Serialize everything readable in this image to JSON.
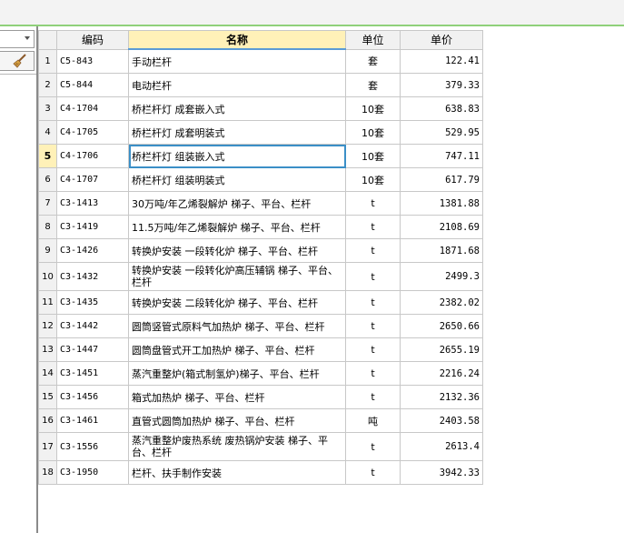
{
  "columns": {
    "code": "编码",
    "name": "名称",
    "unit": "单位",
    "price": "单价"
  },
  "rows": [
    {
      "n": "1",
      "code": "C5-843",
      "name": "手动栏杆",
      "unit": "套",
      "price": "122.41"
    },
    {
      "n": "2",
      "code": "C5-844",
      "name": "电动栏杆",
      "unit": "套",
      "price": "379.33"
    },
    {
      "n": "3",
      "code": "C4-1704",
      "name": "桥栏杆灯 成套嵌入式",
      "unit": "10套",
      "price": "638.83"
    },
    {
      "n": "4",
      "code": "C4-1705",
      "name": "桥栏杆灯 成套明装式",
      "unit": "10套",
      "price": "529.95"
    },
    {
      "n": "5",
      "code": "C4-1706",
      "name": "桥栏杆灯 组装嵌入式",
      "unit": "10套",
      "price": "747.11"
    },
    {
      "n": "6",
      "code": "C4-1707",
      "name": "桥栏杆灯 组装明装式",
      "unit": "10套",
      "price": "617.79"
    },
    {
      "n": "7",
      "code": "C3-1413",
      "name": "30万吨/年乙烯裂解炉 梯子、平台、栏杆",
      "unit": "t",
      "price": "1381.88"
    },
    {
      "n": "8",
      "code": "C3-1419",
      "name": "11.5万吨/年乙烯裂解炉 梯子、平台、栏杆",
      "unit": "t",
      "price": "2108.69"
    },
    {
      "n": "9",
      "code": "C3-1426",
      "name": "转换炉安装 一段转化炉 梯子、平台、栏杆",
      "unit": "t",
      "price": "1871.68"
    },
    {
      "n": "10",
      "code": "C3-1432",
      "name": "转换炉安装 一段转化炉高压辅锅 梯子、平台、栏杆",
      "unit": "t",
      "price": "2499.3"
    },
    {
      "n": "11",
      "code": "C3-1435",
      "name": "转换炉安装 二段转化炉 梯子、平台、栏杆",
      "unit": "t",
      "price": "2382.02"
    },
    {
      "n": "12",
      "code": "C3-1442",
      "name": "圆筒竖管式原料气加热炉 梯子、平台、栏杆",
      "unit": "t",
      "price": "2650.66"
    },
    {
      "n": "13",
      "code": "C3-1447",
      "name": "圆筒盘管式开工加热炉 梯子、平台、栏杆",
      "unit": "t",
      "price": "2655.19"
    },
    {
      "n": "14",
      "code": "C3-1451",
      "name": "蒸汽重整炉(箱式制氢炉)梯子、平台、栏杆",
      "unit": "t",
      "price": "2216.24"
    },
    {
      "n": "15",
      "code": "C3-1456",
      "name": "箱式加热炉 梯子、平台、栏杆",
      "unit": "t",
      "price": "2132.36"
    },
    {
      "n": "16",
      "code": "C3-1461",
      "name": "直管式圆筒加热炉 梯子、平台、栏杆",
      "unit": "吨",
      "price": "2403.58"
    },
    {
      "n": "17",
      "code": "C3-1556",
      "name": "蒸汽重整炉废热系统 废热锅炉安装 梯子、平台、栏杆",
      "unit": "t",
      "price": "2613.4"
    },
    {
      "n": "18",
      "code": "C3-1950",
      "name": "栏杆、扶手制作安装",
      "unit": "t",
      "price": "3942.33"
    }
  ]
}
